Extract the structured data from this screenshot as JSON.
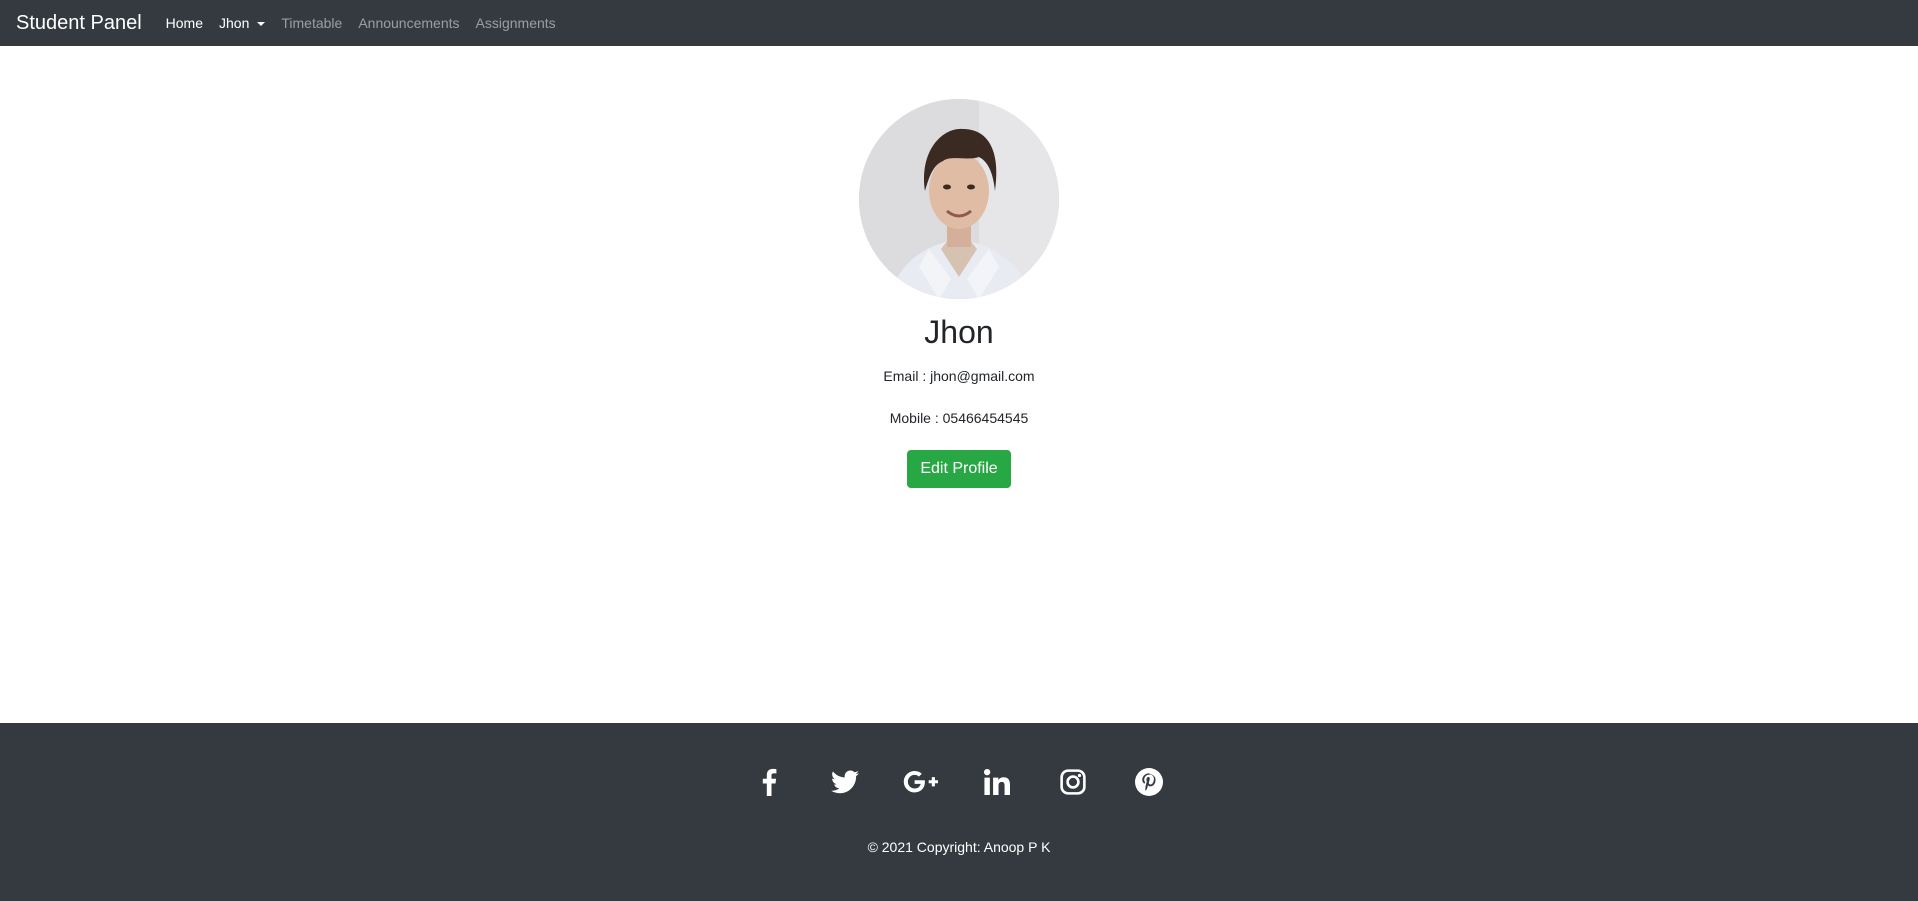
{
  "navbar": {
    "brand": "Student Panel",
    "links": [
      {
        "label": "Home",
        "active": true
      },
      {
        "label": "Jhon",
        "dropdown": true
      },
      {
        "label": "Timetable"
      },
      {
        "label": "Announcements"
      },
      {
        "label": "Assignments"
      }
    ]
  },
  "profile": {
    "name": "Jhon",
    "email_line": "Email : jhon@gmail.com",
    "mobile_line": "Mobile : 05466454545",
    "edit_button": "Edit Profile"
  },
  "footer": {
    "social": [
      "facebook-icon",
      "twitter-icon",
      "google-plus-icon",
      "linkedin-icon",
      "instagram-icon",
      "pinterest-icon"
    ],
    "copyright": "© 2021 Copyright: Anoop P K"
  },
  "colors": {
    "navbar_bg": "#343a40",
    "footer_bg": "#343a40",
    "button_bg": "#28a745"
  }
}
